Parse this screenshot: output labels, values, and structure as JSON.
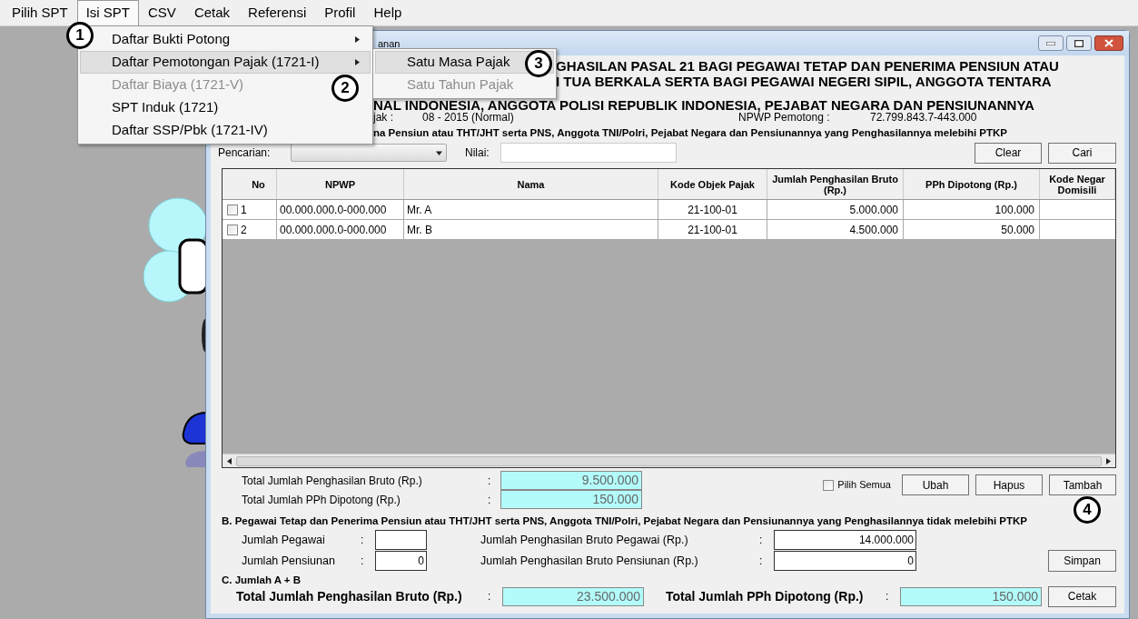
{
  "menubar": [
    {
      "label": "Pilih SPT",
      "selected": false
    },
    {
      "label": "Isi SPT",
      "selected": true
    },
    {
      "label": "CSV",
      "selected": false
    },
    {
      "label": "Cetak",
      "selected": false
    },
    {
      "label": "Referensi",
      "selected": false
    },
    {
      "label": "Profil",
      "selected": false
    },
    {
      "label": "Help",
      "selected": false
    }
  ],
  "menu": [
    {
      "label": "Daftar Bukti Potong",
      "submenu": true,
      "selected": false,
      "disabled": false
    },
    {
      "label": "Daftar Pemotongan Pajak (1721-I)",
      "submenu": true,
      "selected": true,
      "disabled": false
    },
    {
      "label": "Daftar Biaya  (1721-V)",
      "submenu": false,
      "selected": false,
      "disabled": true
    },
    {
      "label": "SPT Induk  (1721)",
      "submenu": false,
      "selected": false,
      "disabled": false
    },
    {
      "label": "Daftar SSP/Pbk  (1721-IV)",
      "submenu": false,
      "selected": false,
      "disabled": false
    }
  ],
  "submenu": [
    {
      "label": "Satu Masa Pajak",
      "selected": true,
      "disabled": false
    },
    {
      "label": "Satu Tahun Pajak",
      "selected": false,
      "disabled": true
    }
  ],
  "callouts": [
    "1",
    "2",
    "3",
    "4"
  ],
  "window": {
    "title": "anan",
    "heading": [
      "GHASILAN PASAL 21 BAGI PEGAWAI TETAP DAN PENERIMA PENSIUN ATAU",
      "I TUA BERKALA SERTA BAGI PEGAWAI NEGERI SIPIL, ANGGOTA TENTARA",
      "NAL INDONESIA, ANGGOTA POLISI REPUBLIK INDONESIA, PEJABAT NEGARA DAN PENSIUNANNYA"
    ],
    "masa_label": "jak :",
    "masa_value": "08 - 2015 (Normal)",
    "npwp_label": "NPWP Pemotong :",
    "npwp_value": "72.799.843.7-443.000",
    "section_a": "na Pensiun atau THT/JHT serta PNS, Anggota TNI/Polri, Pejabat Negara dan Pensiunannya yang Penghasilannya melebihi PTKP",
    "search": {
      "label": "Pencarian:",
      "value_label": "Nilai:",
      "clear": "Clear",
      "find": "Cari"
    },
    "table": {
      "columns": [
        "No",
        "NPWP",
        "Nama",
        "Kode Objek Pajak",
        "Jumlah Penghasilan Bruto (Rp.)",
        "PPh Dipotong (Rp.)",
        "Kode Negar Domisili"
      ],
      "rows": [
        {
          "checked": false,
          "cells": [
            "1",
            "00.000.000.0-000.000",
            "Mr. A",
            "21-100-01",
            "5.000.000",
            "100.000"
          ]
        },
        {
          "checked": false,
          "cells": [
            "2",
            "00.000.000.0-000.000",
            "Mr. B",
            "21-100-01",
            "4.500.000",
            "50.000"
          ]
        }
      ]
    },
    "totals_a": [
      {
        "label": "Total Jumlah Penghasilan Bruto (Rp.)",
        "colon": ":",
        "value": "9.500.000"
      },
      {
        "label": "Total Jumlah PPh Dipotong (Rp.)",
        "colon": ":",
        "value": "150.000"
      }
    ],
    "select_all": {
      "label": "Pilih Semua",
      "checked": false
    },
    "row_buttons": [
      "Ubah",
      "Hapus",
      "Tambah"
    ],
    "section_b": "B. Pegawai Tetap dan Penerima Pensiun atau THT/JHT serta PNS, Anggota TNI/Polri, Pejabat Negara dan Pensiunannya yang Penghasilannya tidak melebihi PTKP",
    "b_fields": [
      {
        "label": "Jumlah Pegawai",
        "colon": ":",
        "label2": "Jumlah Penghasilan Bruto Pegawai (Rp.)",
        "colon2": ":",
        "value2": "14.000.000"
      },
      {
        "label": "Jumlah Pensiunan",
        "colon": ":",
        "value": "0",
        "label2": "Jumlah Penghasilan Bruto Pensiunan (Rp.)",
        "colon2": ":",
        "value2": "0"
      }
    ],
    "save": "Simpan",
    "section_c": "C. Jumlah A + B",
    "totals_c": [
      {
        "label": "Total Jumlah Penghasilan Bruto (Rp.)",
        "colon": ":",
        "value": "23.500.000"
      },
      {
        "label": "Total Jumlah PPh Dipotong (Rp.)",
        "colon": ":",
        "value": "150.000"
      }
    ],
    "print": "Cetak"
  }
}
